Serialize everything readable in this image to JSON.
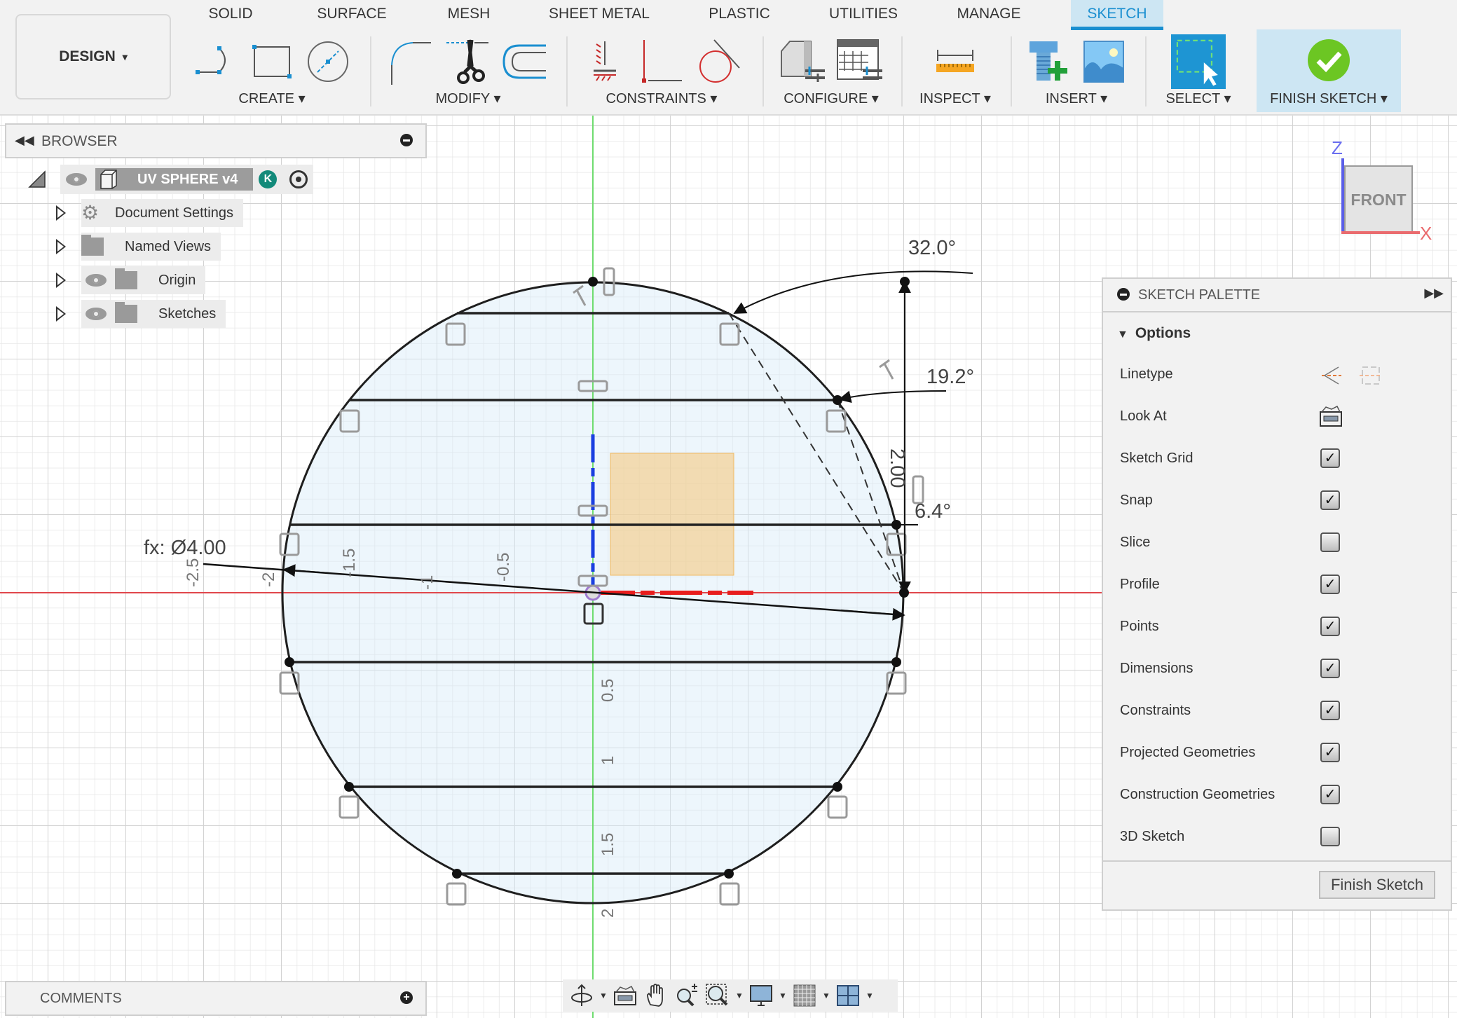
{
  "toolbar": {
    "workspace": "DESIGN",
    "tabs": [
      {
        "label": "SOLID",
        "active": false
      },
      {
        "label": "SURFACE",
        "active": false
      },
      {
        "label": "MESH",
        "active": false
      },
      {
        "label": "SHEET METAL",
        "active": false
      },
      {
        "label": "PLASTIC",
        "active": false
      },
      {
        "label": "UTILITIES",
        "active": false
      },
      {
        "label": "MANAGE",
        "active": false
      },
      {
        "label": "SKETCH",
        "active": true
      }
    ],
    "groups": {
      "create": "CREATE",
      "modify": "MODIFY",
      "constraints": "CONSTRAINTS",
      "configure": "CONFIGURE",
      "inspect": "INSPECT",
      "insert": "INSERT",
      "select": "SELECT",
      "finish_sketch": "FINISH SKETCH"
    },
    "dropdown_glyph": "▾"
  },
  "browser": {
    "title": "BROWSER",
    "root": {
      "label": "UV SPHERE v4",
      "badge": "K"
    },
    "items": [
      {
        "label": "Document Settings",
        "icon": "gear-icon"
      },
      {
        "label": "Named Views",
        "icon": "folder-icon"
      },
      {
        "label": "Origin",
        "icon": "folder-icon"
      },
      {
        "label": "Sketches",
        "icon": "folder-icon"
      }
    ]
  },
  "comments": {
    "title": "COMMENTS"
  },
  "viewcube": {
    "face": "FRONT",
    "axis_z": "Z",
    "axis_x": "X"
  },
  "sketch": {
    "diameter_label": "fx: Ø4.00",
    "angles": [
      "32.0°",
      "19.2°",
      "6.4°"
    ],
    "length_label": "2.00",
    "x_ticks": [
      "-2.5",
      "-2",
      "-1.5",
      "-1",
      "-0.5"
    ],
    "y_ticks": [
      "0.5",
      "1",
      "1.5",
      "2"
    ]
  },
  "palette": {
    "title": "SKETCH PALETTE",
    "section": "Options",
    "rows": [
      {
        "label": "Linetype",
        "type": "icons"
      },
      {
        "label": "Look At",
        "type": "icon"
      },
      {
        "label": "Sketch Grid",
        "type": "checkbox",
        "checked": true
      },
      {
        "label": "Snap",
        "type": "checkbox",
        "checked": true
      },
      {
        "label": "Slice",
        "type": "checkbox",
        "checked": false
      },
      {
        "label": "Profile",
        "type": "checkbox",
        "checked": true
      },
      {
        "label": "Points",
        "type": "checkbox",
        "checked": true
      },
      {
        "label": "Dimensions",
        "type": "checkbox",
        "checked": true
      },
      {
        "label": "Constraints",
        "type": "checkbox",
        "checked": true
      },
      {
        "label": "Projected Geometries",
        "type": "checkbox",
        "checked": true
      },
      {
        "label": "Construction Geometries",
        "type": "checkbox",
        "checked": true
      },
      {
        "label": "3D Sketch",
        "type": "checkbox",
        "checked": false
      }
    ],
    "finish_button": "Finish Sketch",
    "check_glyph": "✓"
  },
  "colors": {
    "accent": "#1a8fd0",
    "active_tab_bg": "#cde6f3",
    "x_axis": "#e0474c",
    "y_axis": "#6fdc6f",
    "profile_fill": "#eaf4fb",
    "finish_green": "#6cc623"
  }
}
